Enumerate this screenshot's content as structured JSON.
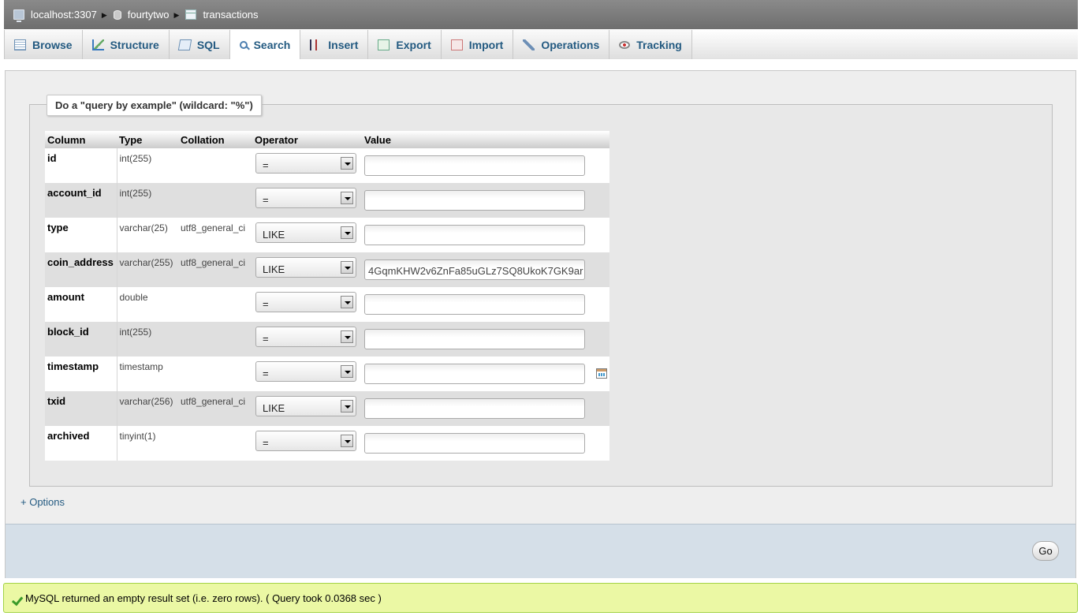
{
  "breadcrumb": {
    "server": "localhost:3307",
    "database": "fourtytwo",
    "table": "transactions"
  },
  "tabs": [
    {
      "label": "Browse",
      "icon": "browse-icon"
    },
    {
      "label": "Structure",
      "icon": "structure-icon"
    },
    {
      "label": "SQL",
      "icon": "sql-icon"
    },
    {
      "label": "Search",
      "icon": "search-icon",
      "active": true
    },
    {
      "label": "Insert",
      "icon": "insert-icon"
    },
    {
      "label": "Export",
      "icon": "export-icon"
    },
    {
      "label": "Import",
      "icon": "import-icon"
    },
    {
      "label": "Operations",
      "icon": "wrench-icon"
    },
    {
      "label": "Tracking",
      "icon": "eye-icon"
    }
  ],
  "search": {
    "legend": "Do a \"query by example\" (wildcard: \"%\")",
    "headers": {
      "column": "Column",
      "type": "Type",
      "collation": "Collation",
      "operator": "Operator",
      "value": "Value"
    },
    "rows": [
      {
        "column": "id",
        "type": "int(255)",
        "collation": "",
        "operator": "=",
        "value": ""
      },
      {
        "column": "account_id",
        "type": "int(255)",
        "collation": "",
        "operator": "=",
        "value": ""
      },
      {
        "column": "type",
        "type": "varchar(25)",
        "collation": "utf8_general_ci",
        "operator": "LIKE",
        "value": ""
      },
      {
        "column": "coin_address",
        "type": "varchar(255)",
        "collation": "utf8_general_ci",
        "operator": "LIKE",
        "value": "4GqmKHW2v6ZnFa85uGLz7SQ8UkoK7GK9ar"
      },
      {
        "column": "amount",
        "type": "double",
        "collation": "",
        "operator": "=",
        "value": ""
      },
      {
        "column": "block_id",
        "type": "int(255)",
        "collation": "",
        "operator": "=",
        "value": ""
      },
      {
        "column": "timestamp",
        "type": "timestamp",
        "collation": "",
        "operator": "=",
        "value": ""
      },
      {
        "column": "txid",
        "type": "varchar(256)",
        "collation": "utf8_general_ci",
        "operator": "LIKE",
        "value": ""
      },
      {
        "column": "archived",
        "type": "tinyint(1)",
        "collation": "",
        "operator": "=",
        "value": ""
      }
    ],
    "options_link": "+ Options",
    "go_label": "Go"
  },
  "message": {
    "text": "MySQL returned an empty result set (i.e. zero rows). ( Query took 0.0368 sec )",
    "icon": "check-icon"
  }
}
